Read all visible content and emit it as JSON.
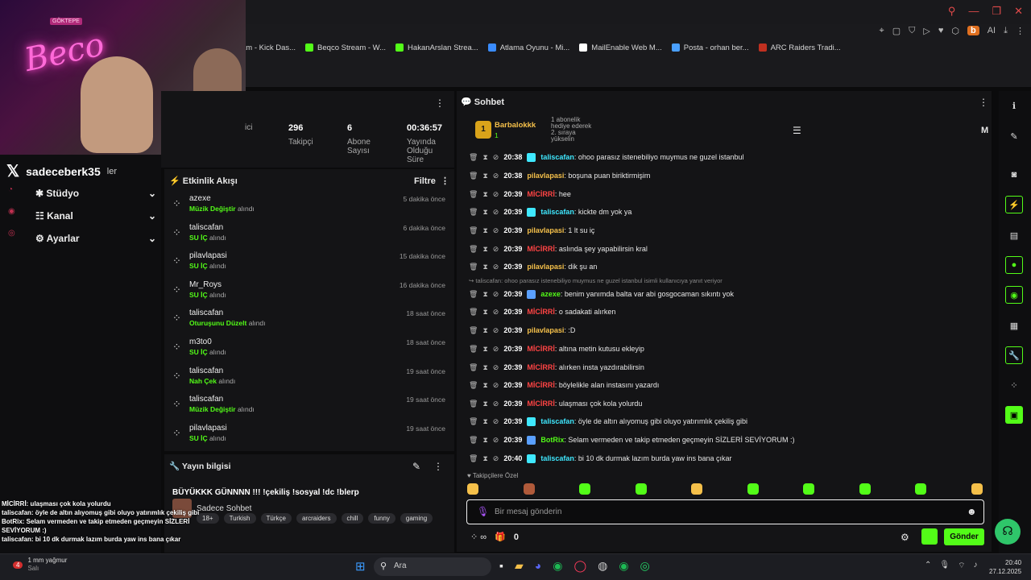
{
  "bookmarks": [
    "am - Kick Das...",
    "Beqco Stream - W...",
    "HakanArslan Strea...",
    "Atlama Oyunu - Mi...",
    "MailEnable Web M...",
    "Posta - orhan ber...",
    "ARC Raiders Tradi..."
  ],
  "toolbar": {
    "ext_b": "b",
    "ai": "AI"
  },
  "webcam": {
    "badge": "GÖKTEPE",
    "neon": "Beco"
  },
  "sidebar": {
    "username": "sadeceberk35",
    "suffix": "ler",
    "items": [
      {
        "label": "Stüdyo"
      },
      {
        "label": "Kanal"
      },
      {
        "label": "Ayarlar"
      }
    ]
  },
  "stats": {
    "followers": "296",
    "followers_label": "Takipçi",
    "subs": "6",
    "subs_label": "Abone\nSayısı",
    "uptime": "00:36:57",
    "uptime_label": "Yayında\nOlduğu\nSüre",
    "cut_label": "ici"
  },
  "activity": {
    "title": "Etkinlik Akışı",
    "filter": "Filtre",
    "suffix": "alındı",
    "items": [
      {
        "name": "azexe",
        "reward": "Müzik Değiştir",
        "time": "5 dakika önce"
      },
      {
        "name": "taliscafan",
        "reward": "SU İÇ",
        "time": "6 dakika önce"
      },
      {
        "name": "pilavlapasi",
        "reward": "SU İÇ",
        "time": "15 dakika önce"
      },
      {
        "name": "Mr_Roys",
        "reward": "SU İÇ",
        "time": "16 dakika önce"
      },
      {
        "name": "taliscafan",
        "reward": "Oturuşunu Düzelt",
        "time": "18 saat önce"
      },
      {
        "name": "m3to0",
        "reward": "SU İÇ",
        "time": "18 saat önce"
      },
      {
        "name": "taliscafan",
        "reward": "Nah Çek",
        "time": "19 saat önce"
      },
      {
        "name": "taliscafan",
        "reward": "Müzik Değiştir",
        "time": "19 saat önce"
      },
      {
        "name": "pilavlapasi",
        "reward": "SU İÇ",
        "time": "19 saat önce"
      }
    ]
  },
  "stream_info": {
    "title": "Yayın bilgisi",
    "stream_title": "BÜYÜKKK GÜNNNN !!! !çekiliş !sosyal !dc !blerp",
    "category": "Sadece Sohbet",
    "tags": [
      "18+",
      "Turkish",
      "Türkçe",
      "arcraiders",
      "chill",
      "funny",
      "gaming"
    ]
  },
  "chat": {
    "title": "Sohbet",
    "pinned_user": "Barbalokkk",
    "pinned_rank": "1",
    "pinned_count": "1",
    "pinned_text": "1 abonelik hediye ederek 2. sıraya yükselin",
    "m_label": "M",
    "reply_note": "taliscafan: ohoo parasız istenebiliyo muymus ne guzel istanbul isimli kullanıcıya yanıt veriyor",
    "messages": [
      {
        "time": "20:38",
        "user": "taliscafan",
        "cls": "u-green",
        "text": ": ohoo parasız istenebiliyo muymus ne guzel istanbul"
      },
      {
        "time": "20:38",
        "user": "pilavlapasi",
        "cls": "u-gold",
        "text": ": boşuna puan biriktirmişim"
      },
      {
        "time": "20:39",
        "user": "MİCİRRİ",
        "cls": "u-red",
        "text": ": hee"
      },
      {
        "time": "20:39",
        "user": "taliscafan",
        "cls": "u-green",
        "text": ": kickte dm yok ya"
      },
      {
        "time": "20:39",
        "user": "pilavlapasi",
        "cls": "u-gold",
        "text": ": 1 lt su iç"
      },
      {
        "time": "20:39",
        "user": "MİCİRRİ",
        "cls": "u-red",
        "text": ": aslında şey yapabilirsin kral"
      },
      {
        "time": "20:39",
        "user": "pilavlapasi",
        "cls": "u-gold",
        "text": ": dik şu an"
      },
      {
        "time": "20:39",
        "user": "azexe",
        "cls": "u-bot",
        "text": ": benim yanımda balta var abi gosgocaman sıkıntı yok"
      },
      {
        "time": "20:39",
        "user": "MİCİRRİ",
        "cls": "u-red",
        "text": ": o sadakati alırken"
      },
      {
        "time": "20:39",
        "user": "pilavlapasi",
        "cls": "u-gold",
        "text": ": :D"
      },
      {
        "time": "20:39",
        "user": "MİCİRRİ",
        "cls": "u-red",
        "text": ": altına metin kutusu ekleyip"
      },
      {
        "time": "20:39",
        "user": "MİCİRRİ",
        "cls": "u-red",
        "text": ": alırken insta yazdırabilirsin"
      },
      {
        "time": "20:39",
        "user": "MİCİRRİ",
        "cls": "u-red",
        "text": ": böylelikle alan instasını yazardı"
      },
      {
        "time": "20:39",
        "user": "MİCİRRİ",
        "cls": "u-red",
        "text": ": ulaşması çok kola yolurdu"
      },
      {
        "time": "20:39",
        "user": "taliscafan",
        "cls": "u-green",
        "text": ": öyle de altın alıyomuş gibi oluyo yatırımlık çekiliş gibi"
      },
      {
        "time": "20:39",
        "user": "BotRix",
        "cls": "u-bot",
        "text": ": Selam vermeden ve takip etmeden geçmeyin SİZLERİ SEVİYORUM :)"
      },
      {
        "time": "20:40",
        "user": "taliscafan",
        "cls": "u-green",
        "text": ": bi 10 dk durmak lazım burda yaw ins bana çıkar"
      }
    ],
    "followers_only": "Takipçilere Özel",
    "placeholder": "Bir mesaj gönderin",
    "send": "Gönder",
    "points": "0"
  },
  "overlay_chat": [
    "MİCİRRİ: ulaşması çok kola yolurdu",
    "taliscafan: öyle de altın alıyomuş gibi oluyo yatırımlık çekiliş gibi",
    "BotRix: Selam vermeden ve takip etmeden geçmeyin SİZLERİ SEVİYORUM :)",
    "taliscafan: bi 10 dk durmak lazım burda yaw ins bana çıkar"
  ],
  "taskbar": {
    "weather_count": "4",
    "weather": "1 mm yağmur",
    "weather_sub": "Salı",
    "search": "Ara",
    "time": "20:40",
    "date": "27.12.2025"
  }
}
